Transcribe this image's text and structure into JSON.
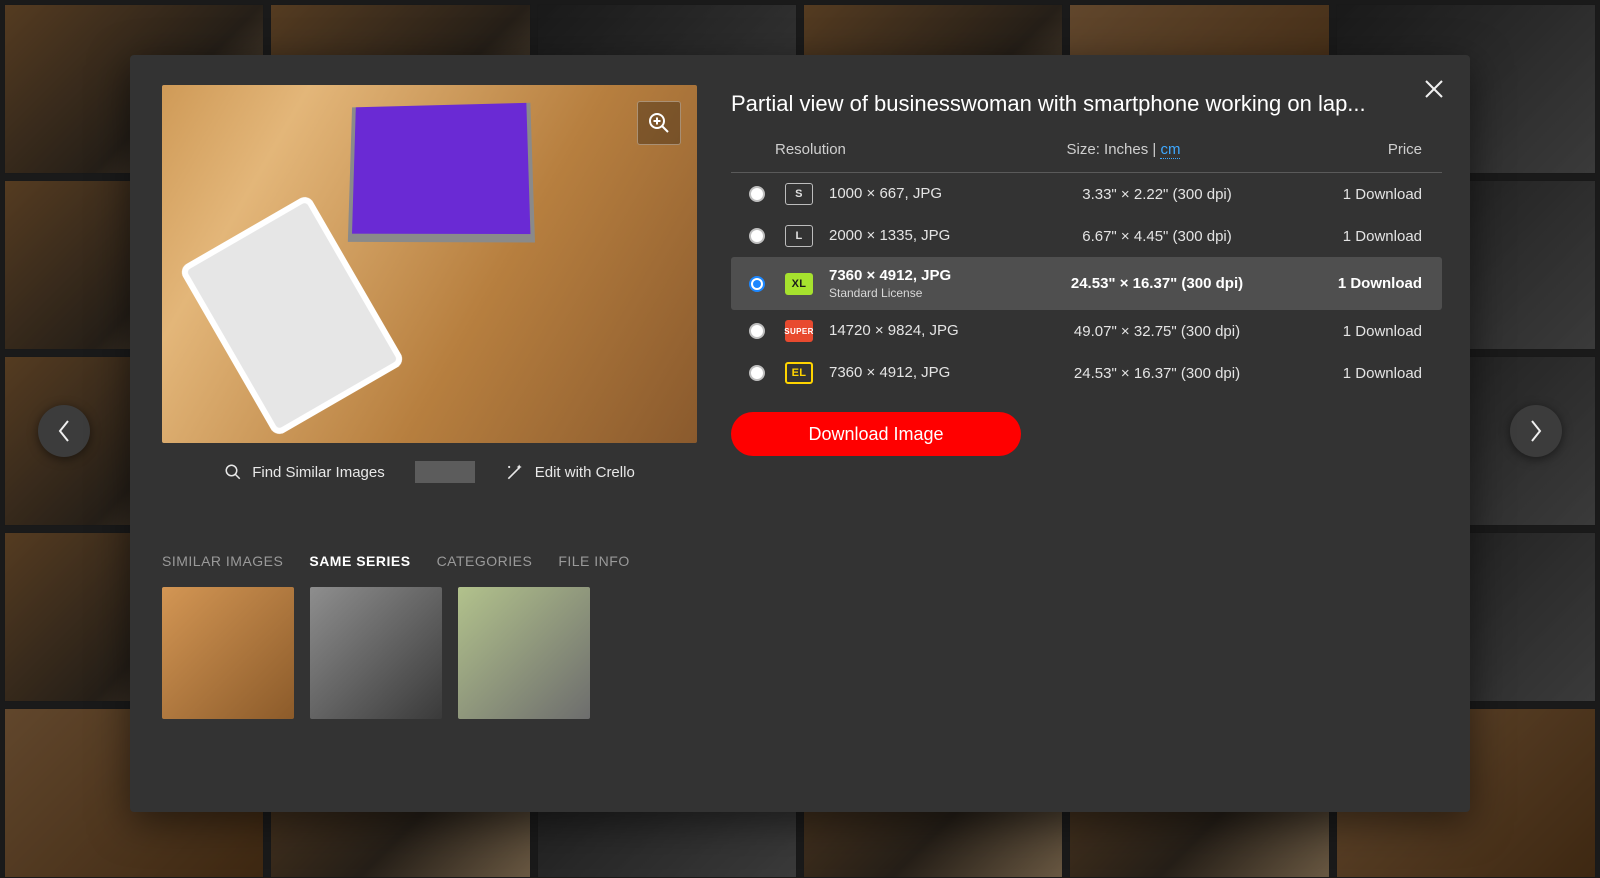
{
  "title": "Partial view of businesswoman with smartphone working on lap...",
  "zoom_icon": "zoom-in",
  "preview_actions": {
    "find_similar": "Find Similar Images",
    "edit_crello": "Edit with Crello"
  },
  "table_headers": {
    "resolution": "Resolution",
    "size_prefix": "Size: Inches | ",
    "size_cm": "cm",
    "price": "Price"
  },
  "resolutions": [
    {
      "badge": "S",
      "badge_class": "b-s",
      "res": "1000 × 667, JPG",
      "sub": "",
      "size": "3.33\" × 2.22\" (300 dpi)",
      "price": "1 Download",
      "selected": false
    },
    {
      "badge": "L",
      "badge_class": "b-l",
      "res": "2000 × 1335, JPG",
      "sub": "",
      "size": "6.67\" × 4.45\" (300 dpi)",
      "price": "1 Download",
      "selected": false
    },
    {
      "badge": "XL",
      "badge_class": "b-xl",
      "res": "7360 × 4912, JPG",
      "sub": "Standard License",
      "size": "24.53\" × 16.37\" (300 dpi)",
      "price": "1 Download",
      "selected": true
    },
    {
      "badge": "SUPER",
      "badge_class": "b-super",
      "res": "14720 × 9824, JPG",
      "sub": "",
      "size": "49.07\" × 32.75\" (300 dpi)",
      "price": "1 Download",
      "selected": false
    },
    {
      "badge": "EL",
      "badge_class": "b-el",
      "res": "7360 × 4912, JPG",
      "sub": "",
      "size": "24.53\" × 16.37\" (300 dpi)",
      "price": "1 Download",
      "selected": false
    }
  ],
  "download_button": "Download Image",
  "tabs": {
    "similar": "SIMILAR IMAGES",
    "same_series": "SAME SERIES",
    "categories": "CATEGORIES",
    "file_info": "FILE INFO",
    "active": "same_series"
  },
  "nav": {
    "prev": "Previous",
    "next": "Next"
  }
}
